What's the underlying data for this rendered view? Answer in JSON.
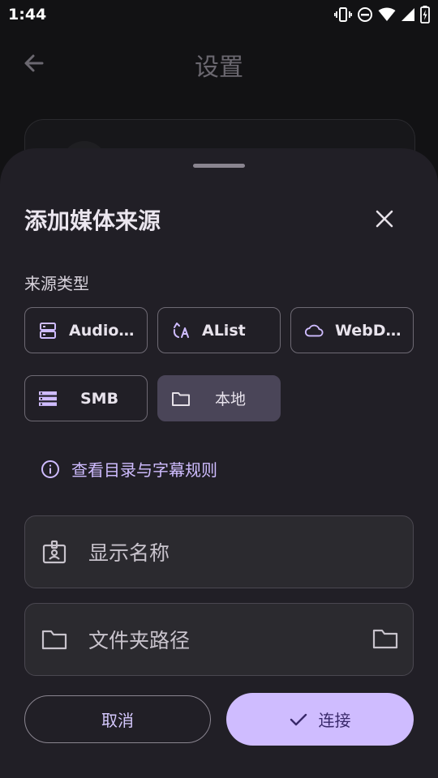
{
  "status_bar": {
    "time": "1:44",
    "icons": [
      "vibrate-icon",
      "dnd-icon",
      "wifi-icon",
      "signal-icon",
      "battery-charging-icon"
    ]
  },
  "background": {
    "title": "设置",
    "back_icon": "arrow-back-icon"
  },
  "sheet": {
    "title": "添加媒体来源",
    "close_icon": "close-icon",
    "section_label": "来源类型",
    "source_types": [
      {
        "label": "Audio…",
        "icon": "server-icon",
        "selected": false
      },
      {
        "label": "AList",
        "icon": "alist-icon",
        "selected": false
      },
      {
        "label": "WebD…",
        "icon": "cloud-icon",
        "selected": false
      },
      {
        "label": "SMB",
        "icon": "storage-icon",
        "selected": false
      },
      {
        "label": "本地",
        "icon": "folder-icon",
        "selected": true
      }
    ],
    "info_link": {
      "label": "查看目录与字幕规则",
      "icon": "info-icon"
    },
    "fields": {
      "display_name": {
        "placeholder": "显示名称",
        "icon": "badge-icon"
      },
      "folder_path": {
        "placeholder": "文件夹路径",
        "icon": "folder-icon",
        "trailing_icon": "folder-picker-icon"
      }
    },
    "buttons": {
      "cancel": "取消",
      "connect": "连接"
    }
  },
  "colors": {
    "accent": "#cfbcff",
    "sheet_bg": "#211f26",
    "selected_chip": "#4a4558",
    "page_bg": "#121214"
  }
}
